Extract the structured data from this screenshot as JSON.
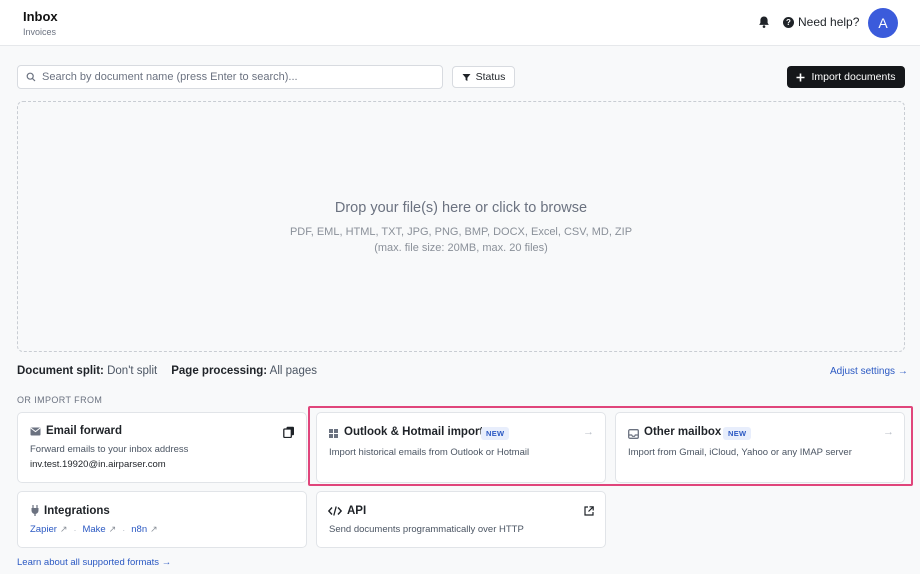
{
  "header": {
    "title": "Inbox",
    "subtitle": "Invoices",
    "help_label": "Need help?",
    "avatar_initial": "A"
  },
  "toolbar": {
    "search_placeholder": "Search by document name (press Enter to search)...",
    "status_label": "Status",
    "import_label": "Import documents"
  },
  "dropzone": {
    "title": "Drop your file(s) here or click to browse",
    "formats": "PDF, EML, HTML, TXT, JPG, PNG, BMP, DOCX, Excel, CSV, MD, ZIP",
    "limits": "(max. file size: 20MB, max. 20 files)"
  },
  "settings": {
    "split_label": "Document split:",
    "split_value": "Don't split",
    "processing_label": "Page processing:",
    "processing_value": "All pages",
    "adjust_label": "Adjust settings →"
  },
  "import_section": {
    "heading": "OR IMPORT FROM",
    "email_forward": {
      "title": "Email forward",
      "desc": "Forward emails to your inbox address",
      "address": "inv.test.19920@in.airparser.com"
    },
    "outlook": {
      "title": "Outlook & Hotmail import",
      "badge": "NEW",
      "desc": "Import historical emails from Outlook or Hotmail"
    },
    "other_mailbox": {
      "title": "Other mailbox",
      "badge": "NEW",
      "desc": "Import from Gmail, iCloud, Yahoo or any IMAP server"
    },
    "integrations": {
      "title": "Integrations",
      "links": [
        "Zapier",
        "Make",
        "n8n"
      ]
    },
    "api": {
      "title": "API",
      "desc": "Send documents programmatically over HTTP"
    },
    "learn_more": "Learn about all supported formats →"
  },
  "icons": {
    "bell": "bell-icon",
    "help": "question-circle-icon",
    "search": "search-icon",
    "filter": "filter-icon",
    "plus": "plus-icon",
    "mail": "mail-icon",
    "copy": "copy-icon",
    "windows": "windows-icon",
    "inbox": "inbox-icon",
    "plug": "plug-icon",
    "code": "code-icon",
    "external": "external-link-icon",
    "arrow": "arrow-right-icon"
  },
  "colors": {
    "accent": "#2b59c3",
    "avatar": "#3b5bdb",
    "highlight": "#e0457b",
    "primary_button": "#15171a"
  }
}
